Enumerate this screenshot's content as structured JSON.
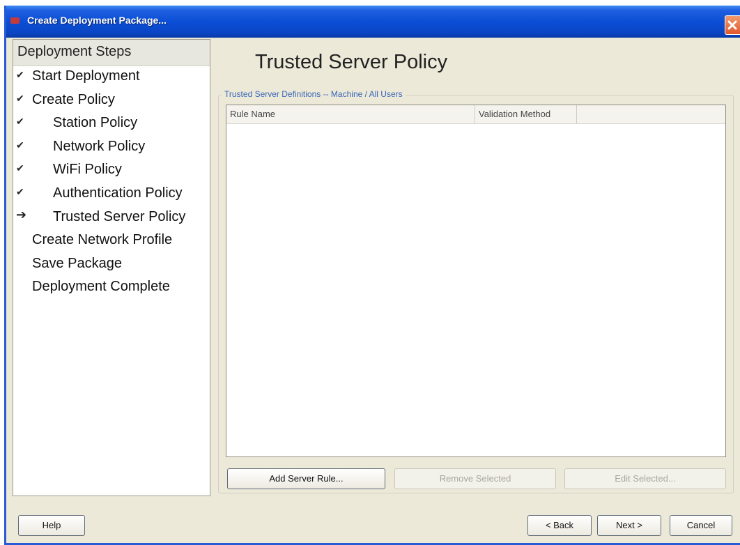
{
  "window": {
    "title": "Create Deployment Package..."
  },
  "sidebar": {
    "header": "Deployment Steps",
    "items": [
      {
        "label": "Start Deployment",
        "mark": "✔"
      },
      {
        "label": "Create Policy",
        "mark": "✔"
      },
      {
        "label": "Station Policy",
        "mark": "✔"
      },
      {
        "label": "Network Policy",
        "mark": "✔"
      },
      {
        "label": "WiFi Policy",
        "mark": "✔"
      },
      {
        "label": "Authentication Policy",
        "mark": "✔"
      },
      {
        "label": "Trusted Server Policy",
        "mark": "➔"
      },
      {
        "label": "Create Network Profile",
        "mark": ""
      },
      {
        "label": "Save Package",
        "mark": ""
      },
      {
        "label": "Deployment Complete",
        "mark": ""
      }
    ]
  },
  "main": {
    "title": "Trusted Server Policy",
    "group_label": "Trusted Server Definitions -- Machine / All Users",
    "columns": [
      "Rule Name",
      "Validation Method"
    ],
    "rows": [],
    "buttons": {
      "add": "Add Server Rule...",
      "remove": "Remove Selected",
      "edit": "Edit Selected..."
    }
  },
  "footer": {
    "help": "Help",
    "back": "< Back",
    "next": "Next >",
    "cancel": "Cancel"
  },
  "colors": {
    "titlebar": "#0b4ed6",
    "window_bg": "#ece9d8",
    "group_label": "#3a66b8",
    "close_button": "#e0582b"
  },
  "icons": {
    "close": "close-icon",
    "app": "app-icon",
    "check": "check-icon",
    "current": "arrow-right-icon"
  }
}
